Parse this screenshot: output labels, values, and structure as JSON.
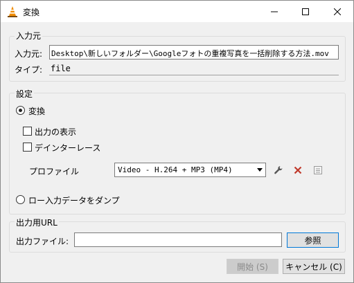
{
  "window": {
    "title": "変換"
  },
  "source": {
    "group_label": "入力元",
    "input_label": "入力元:",
    "input_value": "Desktop\\新しいフォルダー\\Googleフォトの重複写真を一括削除する方法.mov",
    "type_label": "タイプ:",
    "type_value": "file"
  },
  "settings": {
    "group_label": "設定",
    "convert_label": "変換",
    "show_output_label": "出力の表示",
    "deinterlace_label": "デインターレース",
    "profile_label": "プロファイル",
    "profile_value": "Video - H.264 + MP3 (MP4)",
    "dump_raw_label": "ロー入力データをダンプ"
  },
  "output": {
    "group_label": "出力用URL",
    "file_label": "出力ファイル:",
    "file_value": "",
    "browse_label": "参照"
  },
  "footer": {
    "start_label": "開始 (S)",
    "cancel_label": "キャンセル (C)"
  }
}
